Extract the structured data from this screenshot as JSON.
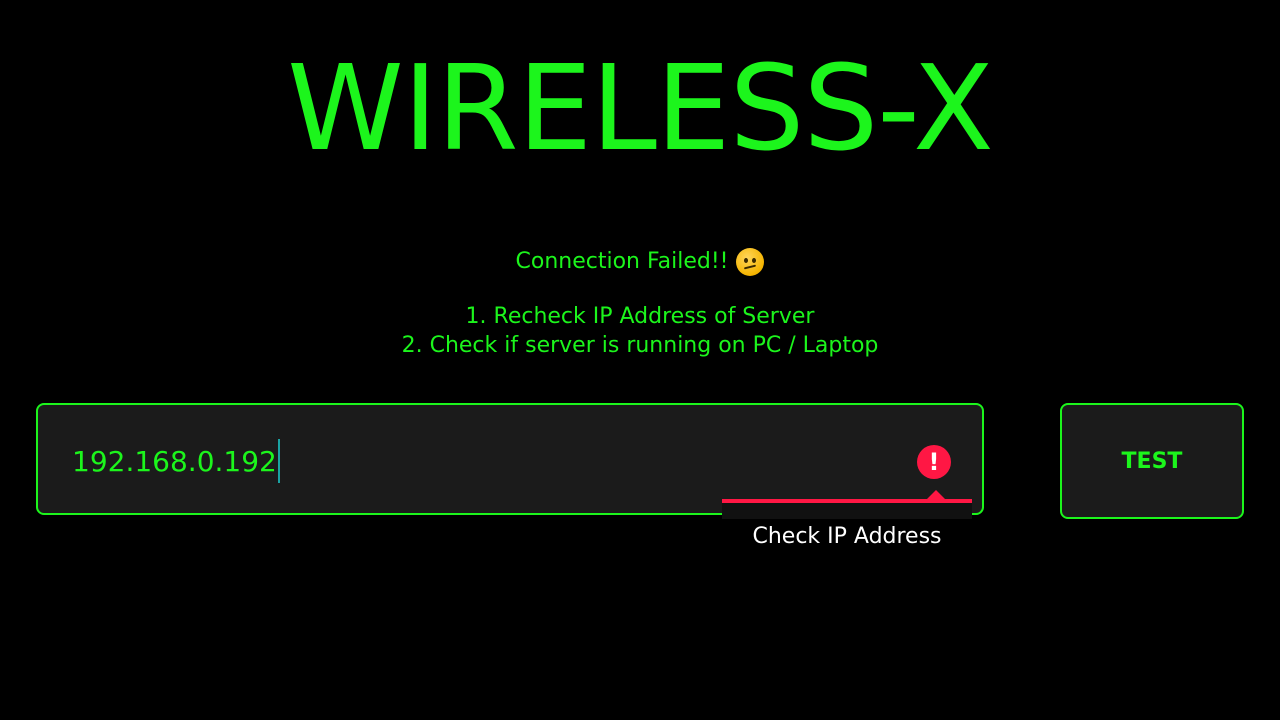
{
  "app": {
    "title": "WIRELESS-X"
  },
  "status": {
    "message": "Connection Failed!!",
    "emoji": "confused-face-icon",
    "instructions": [
      "1. Recheck IP Address of Server",
      "2. Check if server is running on PC / Laptop"
    ]
  },
  "ip_field": {
    "value": "192.168.0.192",
    "error_icon": "error-icon",
    "error_symbol": "!",
    "error_message": "Check IP Address"
  },
  "test_button": {
    "label": "TEST"
  },
  "colors": {
    "background": "#000000",
    "accent": "#1cf51c",
    "field_background": "#1b1b1b",
    "error": "#ff1744",
    "caret": "#1aa3a3"
  }
}
